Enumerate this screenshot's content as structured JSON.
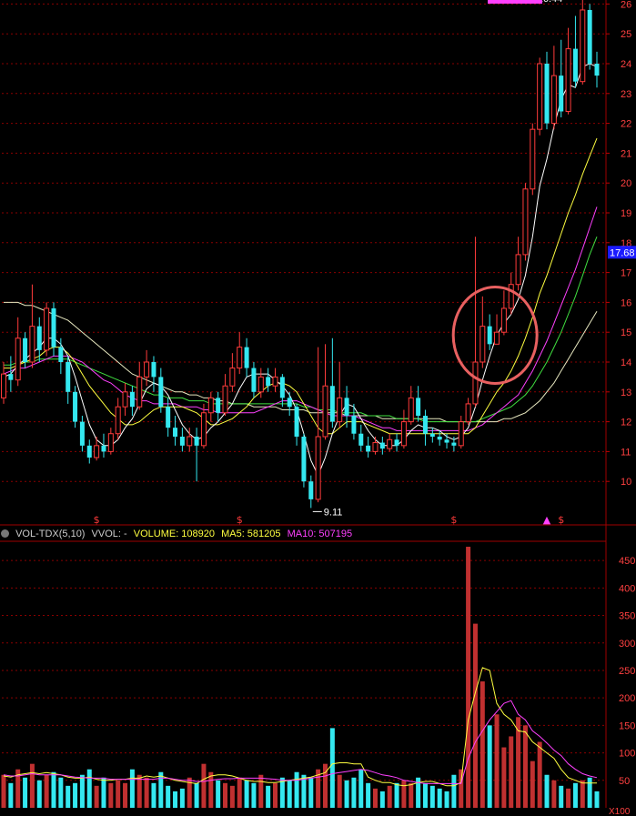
{
  "chart_data": [
    {
      "type": "candlestick",
      "y_axis_labels": [
        "26",
        "25",
        "24",
        "23",
        "22",
        "21",
        "20",
        "19",
        "18",
        "17",
        "16",
        "15",
        "14",
        "13",
        "12",
        "11",
        "10"
      ],
      "ylim": [
        9.0,
        26.5
      ],
      "current_price_label": "17.68",
      "high_annotation": "26.44",
      "low_annotation": "9.11",
      "highlight": "red circle around the breakout bars",
      "colors": {
        "up": "#ff3b3b",
        "down": "#34e8f0",
        "ma5": "#ffffff",
        "ma10": "#ffff40",
        "ma20": "#ff40ff",
        "ma30": "#40e040",
        "ma60": "#e8e8c0",
        "grid": "#8a0000",
        "axis_text": "#ff4040",
        "highlight_label_bg": "#1a1aff"
      },
      "candles": [
        [
          12.8,
          13.6,
          14.0,
          12.6
        ],
        [
          13.6,
          13.4,
          14.2,
          13.0
        ],
        [
          13.4,
          14.8,
          15.5,
          13.2
        ],
        [
          14.8,
          14.0,
          15.0,
          13.8
        ],
        [
          14.0,
          15.2,
          16.6,
          13.8
        ],
        [
          15.2,
          14.4,
          15.5,
          14.0
        ],
        [
          14.4,
          15.8,
          16.0,
          14.2
        ],
        [
          15.8,
          14.5,
          16.0,
          14.2
        ],
        [
          14.5,
          14.0,
          14.8,
          13.6
        ],
        [
          14.0,
          13.0,
          14.2,
          12.6
        ],
        [
          13.0,
          12.0,
          13.2,
          11.8
        ],
        [
          12.0,
          11.2,
          12.2,
          11.0
        ],
        [
          11.2,
          10.8,
          11.4,
          10.6
        ],
        [
          10.8,
          11.2,
          11.5,
          10.7
        ],
        [
          11.2,
          11.0,
          11.6,
          10.8
        ],
        [
          11.0,
          11.6,
          11.8,
          10.9
        ],
        [
          11.6,
          12.5,
          12.8,
          11.4
        ],
        [
          12.5,
          13.0,
          13.3,
          12.2
        ],
        [
          13.0,
          12.5,
          13.2,
          12.2
        ],
        [
          12.5,
          13.5,
          14.0,
          12.4
        ],
        [
          13.5,
          14.0,
          14.4,
          13.2
        ],
        [
          14.0,
          13.5,
          14.2,
          13.0
        ],
        [
          13.5,
          12.5,
          13.8,
          12.3
        ],
        [
          12.5,
          11.8,
          12.8,
          11.5
        ],
        [
          11.8,
          11.5,
          12.2,
          11.2
        ],
        [
          11.5,
          11.2,
          11.8,
          11.0
        ],
        [
          11.2,
          11.5,
          11.8,
          11.0
        ],
        [
          11.5,
          11.2,
          11.8,
          10.0
        ],
        [
          11.2,
          12.3,
          12.6,
          11.1
        ],
        [
          12.3,
          12.8,
          13.0,
          12.0
        ],
        [
          12.8,
          12.3,
          13.0,
          12.0
        ],
        [
          12.3,
          13.2,
          13.6,
          12.2
        ],
        [
          13.2,
          13.8,
          14.3,
          13.0
        ],
        [
          13.8,
          14.5,
          15.0,
          13.6
        ],
        [
          14.5,
          13.8,
          14.8,
          13.5
        ],
        [
          13.8,
          13.0,
          14.0,
          12.8
        ],
        [
          13.0,
          13.5,
          13.8,
          12.8
        ],
        [
          13.5,
          13.2,
          13.8,
          13.0
        ],
        [
          13.2,
          13.5,
          13.8,
          13.0
        ],
        [
          13.5,
          12.8,
          13.6,
          12.5
        ],
        [
          12.8,
          12.5,
          13.0,
          12.2
        ],
        [
          12.5,
          11.5,
          12.6,
          11.2
        ],
        [
          11.5,
          10.0,
          11.6,
          9.8
        ],
        [
          10.0,
          9.4,
          10.2,
          9.11
        ],
        [
          9.4,
          11.5,
          14.5,
          9.3
        ],
        [
          11.5,
          13.2,
          14.6,
          11.4
        ],
        [
          13.2,
          12.0,
          14.8,
          11.8
        ],
        [
          12.0,
          12.8,
          14.0,
          11.8
        ],
        [
          12.8,
          12.2,
          13.2,
          11.8
        ],
        [
          12.2,
          11.6,
          12.6,
          11.4
        ],
        [
          11.6,
          11.2,
          11.9,
          11.0
        ],
        [
          11.2,
          11.0,
          11.5,
          10.8
        ],
        [
          11.0,
          11.3,
          11.5,
          10.9
        ],
        [
          11.3,
          11.1,
          11.5,
          10.9
        ],
        [
          11.1,
          11.4,
          11.6,
          11.0
        ],
        [
          11.4,
          11.2,
          11.6,
          11.0
        ],
        [
          11.2,
          12.0,
          12.4,
          11.1
        ],
        [
          12.0,
          12.8,
          13.2,
          11.9
        ],
        [
          12.8,
          12.2,
          13.2,
          12.0
        ],
        [
          12.2,
          11.6,
          12.4,
          11.2
        ],
        [
          11.6,
          11.5,
          11.8,
          11.3
        ],
        [
          11.5,
          11.4,
          11.7,
          11.2
        ],
        [
          11.4,
          11.3,
          11.6,
          11.1
        ],
        [
          11.3,
          11.2,
          11.5,
          11.0
        ],
        [
          11.2,
          12.0,
          12.2,
          11.1
        ],
        [
          12.0,
          12.6,
          12.8,
          11.9
        ],
        [
          12.6,
          14.0,
          18.2,
          12.5
        ],
        [
          14.0,
          15.2,
          16.2,
          13.8
        ],
        [
          15.2,
          14.6,
          15.6,
          14.4
        ],
        [
          14.6,
          15.0,
          15.6,
          14.6
        ],
        [
          15.0,
          15.8,
          16.4,
          14.9
        ],
        [
          15.8,
          16.6,
          17.0,
          15.6
        ],
        [
          16.6,
          17.6,
          18.2,
          16.4
        ],
        [
          17.6,
          19.8,
          20.0,
          17.4
        ],
        [
          19.8,
          21.8,
          22.0,
          19.6
        ],
        [
          21.8,
          24.0,
          24.2,
          21.6
        ],
        [
          24.0,
          22.0,
          24.4,
          21.8
        ],
        [
          22.0,
          23.6,
          24.6,
          21.8
        ],
        [
          23.6,
          22.4,
          24.8,
          22.2
        ],
        [
          22.4,
          24.5,
          25.2,
          22.3
        ],
        [
          24.5,
          23.4,
          25.6,
          23.2
        ],
        [
          23.4,
          25.8,
          26.44,
          23.3
        ],
        [
          25.8,
          24.0,
          26.0,
          23.8
        ],
        [
          24.0,
          23.6,
          24.4,
          23.2
        ]
      ],
      "ma5": [
        13.5,
        13.6,
        13.9,
        14.1,
        14.3,
        14.5,
        14.8,
        14.8,
        14.6,
        14.2,
        13.5,
        12.7,
        11.9,
        11.4,
        11.2,
        11.2,
        11.4,
        11.8,
        12.1,
        12.6,
        13.1,
        13.3,
        13.2,
        12.9,
        12.4,
        11.9,
        11.6,
        11.4,
        11.5,
        11.8,
        12.0,
        12.3,
        12.6,
        13.1,
        13.5,
        13.6,
        13.6,
        13.6,
        13.4,
        13.2,
        12.9,
        12.4,
        11.6,
        10.7,
        10.2,
        10.8,
        11.6,
        12.2,
        12.6,
        12.5,
        12.1,
        11.7,
        11.4,
        11.2,
        11.2,
        11.2,
        11.4,
        11.7,
        11.9,
        11.8,
        11.8,
        11.7,
        11.5,
        11.4,
        11.5,
        11.8,
        12.5,
        13.4,
        14.2,
        14.9,
        15.3,
        15.6,
        16.1,
        16.9,
        18.2,
        19.9,
        20.8,
        21.9,
        22.8,
        23.3,
        23.2,
        23.9,
        24.0,
        23.9
      ],
      "ma10": [
        13.8,
        13.8,
        13.9,
        14.0,
        14.1,
        14.2,
        14.4,
        14.5,
        14.5,
        14.3,
        14.0,
        13.6,
        13.2,
        12.9,
        12.6,
        12.3,
        12.1,
        11.9,
        11.9,
        12.0,
        12.2,
        12.4,
        12.5,
        12.5,
        12.5,
        12.5,
        12.4,
        12.3,
        12.1,
        11.9,
        11.9,
        12.0,
        12.1,
        12.3,
        12.5,
        12.8,
        13.0,
        13.2,
        13.3,
        13.3,
        13.2,
        13.0,
        12.6,
        12.2,
        11.8,
        11.6,
        11.6,
        11.8,
        12.0,
        12.0,
        12.0,
        11.9,
        11.8,
        11.7,
        11.6,
        11.6,
        11.6,
        11.6,
        11.6,
        11.6,
        11.6,
        11.6,
        11.6,
        11.6,
        11.6,
        11.6,
        11.8,
        12.2,
        12.6,
        13.0,
        13.3,
        13.7,
        14.2,
        14.8,
        15.5,
        16.3,
        16.9,
        17.6,
        18.3,
        19.0,
        19.6,
        20.3,
        20.9,
        21.5
      ],
      "ma20": [
        13.6,
        13.7,
        13.8,
        13.8,
        13.9,
        14.0,
        14.1,
        14.2,
        14.2,
        14.2,
        14.1,
        14.0,
        13.8,
        13.6,
        13.4,
        13.3,
        13.1,
        12.9,
        12.8,
        12.7,
        12.7,
        12.6,
        12.6,
        12.6,
        12.6,
        12.5,
        12.5,
        12.5,
        12.4,
        12.4,
        12.3,
        12.3,
        12.3,
        12.3,
        12.3,
        12.3,
        12.4,
        12.5,
        12.6,
        12.7,
        12.7,
        12.7,
        12.6,
        12.5,
        12.4,
        12.3,
        12.2,
        12.2,
        12.2,
        12.2,
        12.1,
        12.0,
        11.9,
        11.8,
        11.8,
        11.7,
        11.7,
        11.7,
        11.7,
        11.7,
        11.7,
        11.7,
        11.7,
        11.7,
        11.7,
        11.7,
        11.8,
        11.9,
        12.1,
        12.3,
        12.5,
        12.7,
        12.9,
        13.3,
        13.7,
        14.2,
        14.7,
        15.3,
        15.9,
        16.5,
        17.1,
        17.8,
        18.5,
        19.2
      ],
      "ma30": [
        13.9,
        13.9,
        14.0,
        14.0,
        14.0,
        14.1,
        14.1,
        14.1,
        14.1,
        14.1,
        14.0,
        13.9,
        13.8,
        13.7,
        13.6,
        13.5,
        13.4,
        13.3,
        13.2,
        13.1,
        13.0,
        12.9,
        12.9,
        12.8,
        12.8,
        12.8,
        12.7,
        12.7,
        12.7,
        12.6,
        12.6,
        12.6,
        12.6,
        12.6,
        12.6,
        12.6,
        12.6,
        12.6,
        12.6,
        12.6,
        12.6,
        12.6,
        12.5,
        12.5,
        12.4,
        12.4,
        12.4,
        12.3,
        12.3,
        12.3,
        12.3,
        12.2,
        12.2,
        12.2,
        12.2,
        12.1,
        12.1,
        12.1,
        12.1,
        12.0,
        12.0,
        12.0,
        12.0,
        12.0,
        12.0,
        12.0,
        12.0,
        12.1,
        12.2,
        12.3,
        12.4,
        12.5,
        12.7,
        12.9,
        13.2,
        13.6,
        14.0,
        14.5,
        15.0,
        15.6,
        16.2,
        16.9,
        17.6,
        18.2
      ],
      "ma60": [
        16.0,
        16.0,
        16.0,
        15.9,
        15.9,
        15.8,
        15.7,
        15.6,
        15.5,
        15.4,
        15.2,
        15.0,
        14.8,
        14.6,
        14.4,
        14.2,
        14.0,
        13.8,
        13.6,
        13.5,
        13.4,
        13.3,
        13.2,
        13.1,
        13.0,
        13.0,
        12.9,
        12.9,
        12.8,
        12.8,
        12.7,
        12.7,
        12.6,
        12.6,
        12.6,
        12.5,
        12.5,
        12.5,
        12.5,
        12.4,
        12.4,
        12.4,
        12.4,
        12.3,
        12.3,
        12.3,
        12.3,
        12.3,
        12.2,
        12.2,
        12.2,
        12.2,
        12.2,
        12.1,
        12.1,
        12.1,
        12.1,
        12.1,
        12.1,
        12.1,
        12.1,
        12.1,
        12.0,
        12.0,
        12.0,
        12.0,
        12.0,
        12.0,
        12.0,
        12.0,
        12.1,
        12.1,
        12.2,
        12.3,
        12.5,
        12.7,
        13.0,
        13.3,
        13.7,
        14.1,
        14.5,
        14.9,
        15.3,
        15.7
      ],
      "event_markers": [
        {
          "index": 13,
          "symbol": "$"
        },
        {
          "index": 33,
          "symbol": "$"
        },
        {
          "index": 63,
          "symbol": "$"
        },
        {
          "index": 76,
          "symbol": "▲"
        },
        {
          "index": 78,
          "symbol": "$"
        }
      ]
    },
    {
      "type": "bar",
      "legend": [
        {
          "text": "VOL-TDX(5,10)",
          "color": "#cccccc"
        },
        {
          "text": "VVOL: -",
          "color": "#cccccc"
        },
        {
          "text": "VOLUME: 108920",
          "color": "#ffff40"
        },
        {
          "text": "MA5: 581205",
          "color": "#ffff40"
        },
        {
          "text": "MA10: 507195",
          "color": "#ff40ff"
        }
      ],
      "y_axis_labels": [
        "450",
        "400",
        "350",
        "300",
        "250",
        "200",
        "150",
        "100",
        "50"
      ],
      "y_unit_label": "X100",
      "ylim": [
        0,
        480
      ],
      "volumes": [
        60,
        45,
        70,
        55,
        80,
        50,
        60,
        65,
        55,
        40,
        45,
        60,
        70,
        40,
        55,
        45,
        50,
        45,
        70,
        60,
        55,
        45,
        65,
        40,
        30,
        35,
        55,
        45,
        80,
        65,
        50,
        45,
        40,
        55,
        50,
        45,
        60,
        40,
        45,
        55,
        50,
        65,
        60,
        55,
        70,
        80,
        145,
        60,
        50,
        55,
        70,
        45,
        35,
        30,
        40,
        45,
        50,
        45,
        55,
        45,
        40,
        35,
        30,
        60,
        70,
        475,
        335,
        230,
        150,
        170,
        110,
        130,
        165,
        150,
        85,
        120,
        60,
        50,
        40,
        35,
        45,
        50,
        55,
        30
      ],
      "vol_ma5": [
        58,
        56,
        60,
        62,
        64,
        62,
        64,
        62,
        60,
        56,
        54,
        54,
        56,
        52,
        50,
        50,
        52,
        52,
        54,
        54,
        58,
        56,
        58,
        54,
        50,
        48,
        46,
        44,
        52,
        58,
        60,
        60,
        58,
        54,
        50,
        48,
        48,
        46,
        46,
        48,
        50,
        52,
        54,
        56,
        60,
        64,
        80,
        82,
        82,
        80,
        80,
        56,
        50,
        46,
        46,
        42,
        40,
        42,
        46,
        48,
        48,
        44,
        40,
        40,
        46,
        160,
        210,
        255,
        250,
        190,
        170,
        160,
        140,
        138,
        120,
        110,
        100,
        90,
        70,
        55,
        50,
        45,
        45,
        45
      ],
      "vol_ma10": [
        60,
        58,
        58,
        60,
        62,
        60,
        60,
        60,
        60,
        58,
        56,
        55,
        54,
        54,
        54,
        52,
        52,
        52,
        52,
        52,
        52,
        52,
        54,
        54,
        52,
        50,
        50,
        48,
        48,
        50,
        52,
        53,
        53,
        54,
        54,
        54,
        54,
        53,
        52,
        50,
        50,
        50,
        52,
        54,
        56,
        58,
        62,
        64,
        66,
        68,
        70,
        68,
        64,
        60,
        58,
        55,
        50,
        48,
        46,
        44,
        44,
        44,
        44,
        44,
        44,
        90,
        120,
        140,
        160,
        175,
        190,
        195,
        170,
        160,
        140,
        130,
        118,
        105,
        95,
        80,
        70,
        62,
        58,
        55
      ]
    }
  ]
}
